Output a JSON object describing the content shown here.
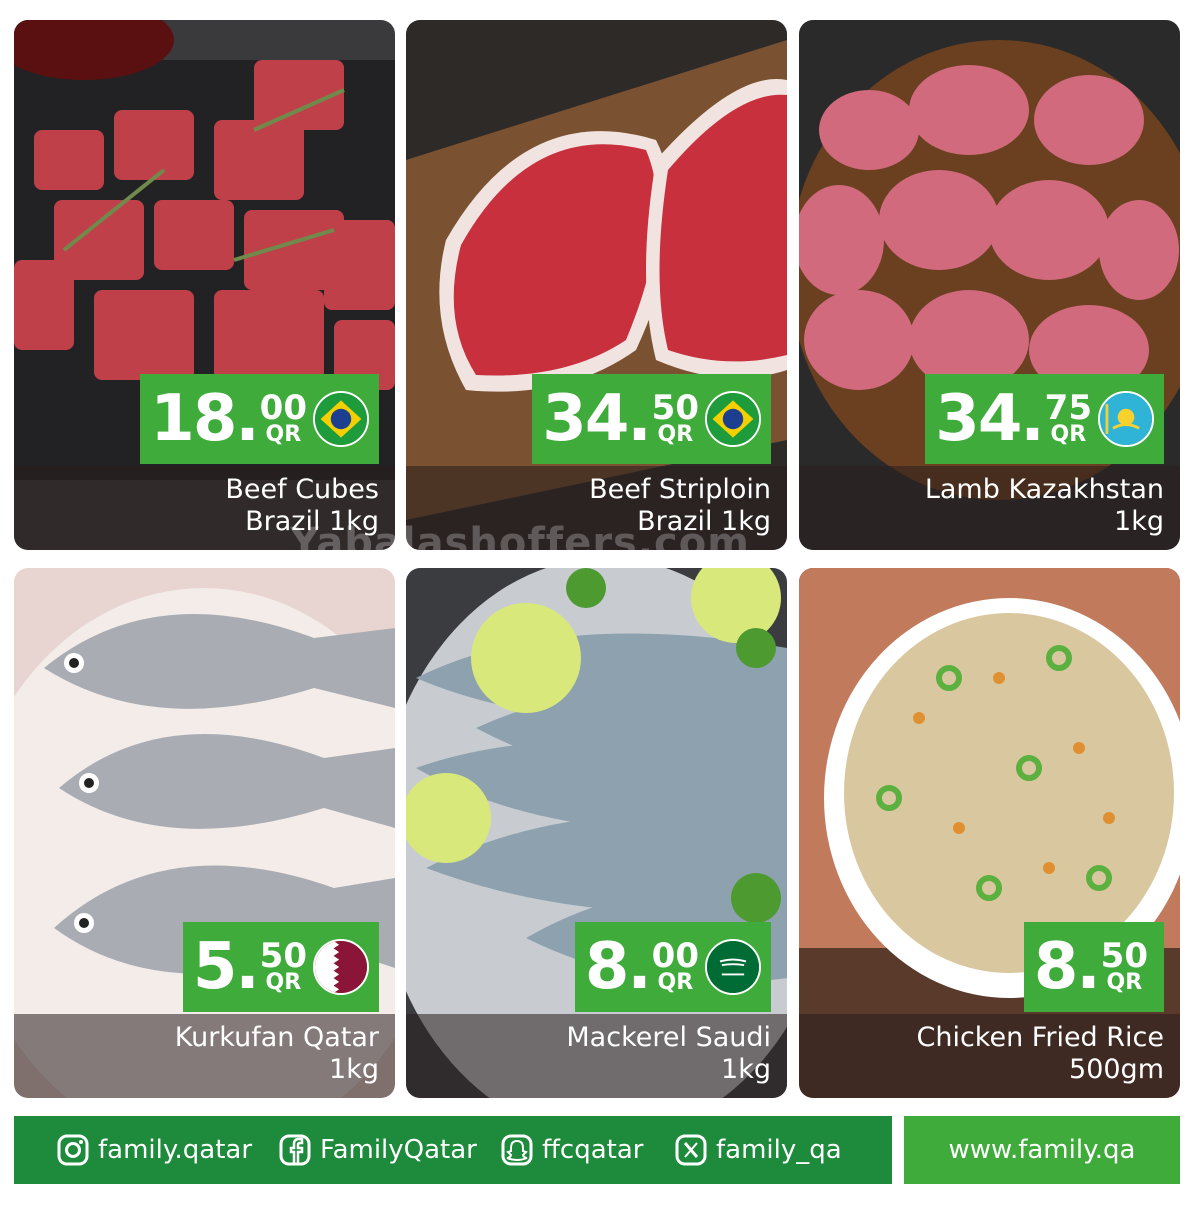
{
  "products": [
    {
      "name_line1": "Beef Cubes",
      "name_line2": "Brazil 1kg",
      "price_int": "18.",
      "price_dec": "00",
      "currency": "QR",
      "flag": "brazil-flag-icon"
    },
    {
      "name_line1": "Beef Striploin",
      "name_line2": "Brazil 1kg",
      "price_int": "34.",
      "price_dec": "50",
      "currency": "QR",
      "flag": "brazil-flag-icon"
    },
    {
      "name_line1": "Lamb Kazakhstan",
      "name_line2": "1kg",
      "price_int": "34.",
      "price_dec": "75",
      "currency": "QR",
      "flag": "kazakhstan-flag-icon"
    },
    {
      "name_line1": "Kurkufan Qatar",
      "name_line2": "1kg",
      "price_int": "5.",
      "price_dec": "50",
      "currency": "QR",
      "flag": "qatar-flag-icon"
    },
    {
      "name_line1": "Mackerel Saudi",
      "name_line2": "1kg",
      "price_int": "8.",
      "price_dec": "00",
      "currency": "QR",
      "flag": "saudi-flag-icon"
    },
    {
      "name_line1": "Chicken Fried Rice",
      "name_line2": "500gm",
      "price_int": "8.",
      "price_dec": "50",
      "currency": "QR",
      "flag": ""
    }
  ],
  "watermark": "Yabalashoffers.com",
  "footer": {
    "instagram": "family.qatar",
    "facebook": "FamilyQatar",
    "snapchat": "ffcqatar",
    "x": "family_qa",
    "website": "www.family.qa"
  },
  "colors": {
    "price_green": "#3fab3b",
    "footer_green": "#1e8a3c"
  }
}
